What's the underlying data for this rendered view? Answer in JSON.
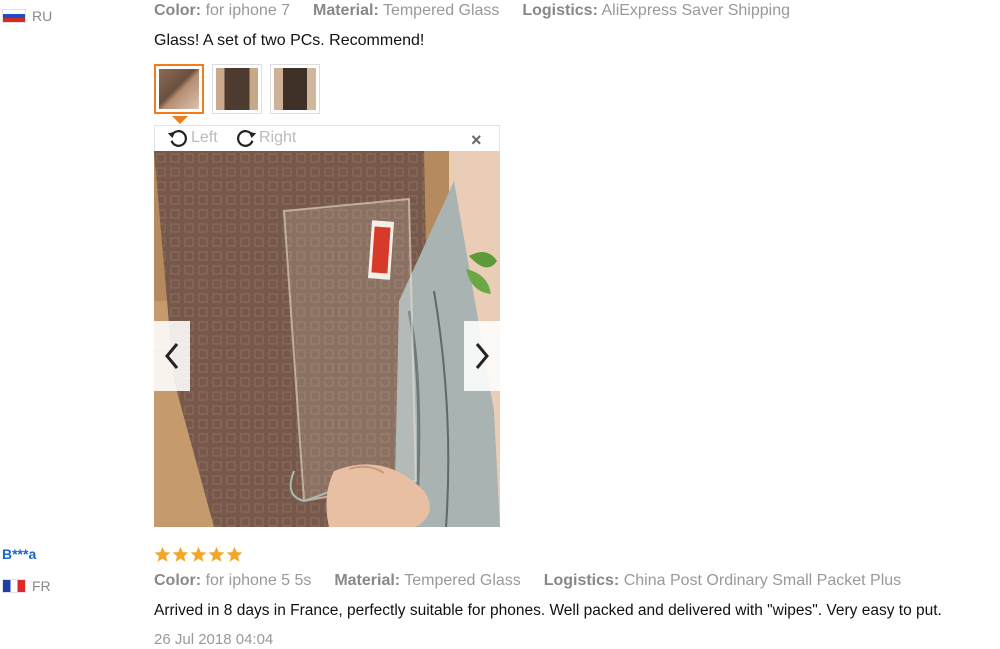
{
  "review1": {
    "country": "RU",
    "attributes": [
      {
        "label": "Color:",
        "value": "for iphone 7"
      },
      {
        "label": "Material:",
        "value": "Tempered Glass"
      },
      {
        "label": "Logistics:",
        "value": "AliExpress Saver Shipping"
      }
    ],
    "text": "Glass! A set of two PCs. Recommend!",
    "viewer": {
      "rotate_left": "Left",
      "rotate_right": "Right",
      "close": "×"
    }
  },
  "review2": {
    "user": "B***a",
    "country": "FR",
    "rating": 5,
    "attributes": [
      {
        "label": "Color:",
        "value": "for iphone 5 5s"
      },
      {
        "label": "Material:",
        "value": "Tempered Glass"
      },
      {
        "label": "Logistics:",
        "value": "China Post Ordinary Small Packet Plus"
      }
    ],
    "text": "Arrived in 8 days in France, perfectly suitable for phones. Well packed and delivered with \"wipes\". Very easy to put.",
    "date": "26 Jul 2018 04:04"
  },
  "colors": {
    "accent_orange": "#f07c1b",
    "star_gold": "#f6a623",
    "user_link": "#1a66cc"
  }
}
